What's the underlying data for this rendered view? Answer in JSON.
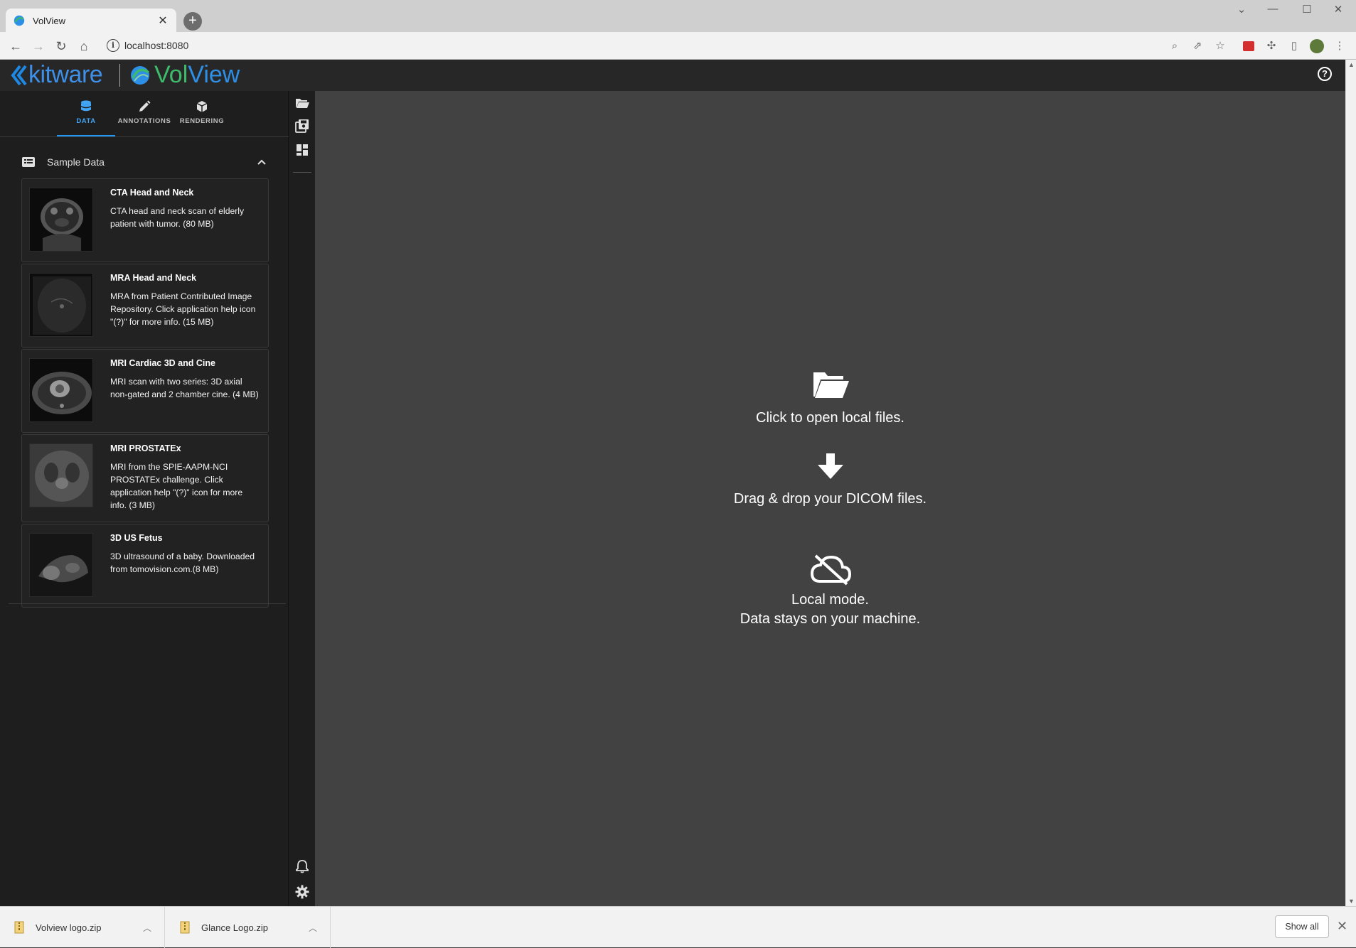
{
  "browser": {
    "tab_title": "VolView",
    "tab_close": "✕",
    "new_tab": "+",
    "url": "localhost:8080",
    "info_icon": "i"
  },
  "app": {
    "brand_kitware": "kitware",
    "brand_volview_vol": "Vol",
    "brand_volview_view": "View",
    "help_icon": "?",
    "colors": {
      "accent": "#2196f3",
      "vol_green": "#3dbb6b",
      "view_blue": "#2e8fe6",
      "appbar": "#272727",
      "panel": "#1e1e1e",
      "main": "#424242"
    }
  },
  "sidebar": {
    "tabs": [
      {
        "label": "DATA",
        "icon": "database-icon",
        "active": true
      },
      {
        "label": "ANNOTATIONS",
        "icon": "pencil-icon",
        "active": false
      },
      {
        "label": "RENDERING",
        "icon": "cube-icon",
        "active": false
      }
    ],
    "section_title": "Sample Data",
    "samples": [
      {
        "title": "CTA Head and Neck",
        "description": "CTA head and neck scan of elderly patient with tumor. (80 MB)"
      },
      {
        "title": "MRA Head and Neck",
        "description": "MRA from Patient Contributed Image Repository. Click application help icon \"(?)\" for more info. (15 MB)"
      },
      {
        "title": "MRI Cardiac 3D and Cine",
        "description": "MRI scan with two series: 3D axial non-gated and 2 chamber cine. (4 MB)"
      },
      {
        "title": "MRI PROSTATEx",
        "description": "MRI from the SPIE-AAPM-NCI PROSTATEx challenge. Click application help \"(?)\" icon for more info. (3 MB)"
      },
      {
        "title": "3D US Fetus",
        "description": "3D ultrasound of a baby. Downloaded from tomovision.com.(8 MB)"
      }
    ]
  },
  "main": {
    "open_files": "Click to open local files.",
    "drag_drop": "Drag & drop your DICOM files.",
    "local_mode_1": "Local mode.",
    "local_mode_2": "Data stays on your machine."
  },
  "downloads": {
    "items": [
      {
        "name": "Volview logo.zip"
      },
      {
        "name": "Glance Logo.zip"
      }
    ],
    "show_all": "Show all",
    "close": "✕"
  }
}
